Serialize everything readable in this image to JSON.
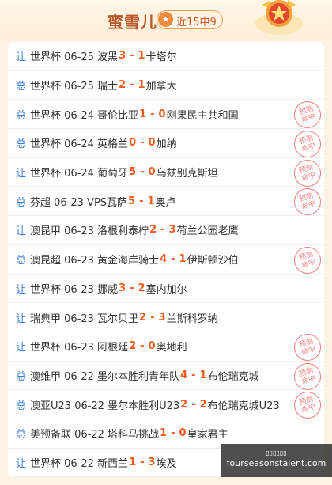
{
  "header": {
    "title": "蜜雪儿",
    "streak_label": "近15中9",
    "star_icon": "★"
  },
  "records": [
    {
      "tag": "让",
      "text": "世界杯 06-25 波黑",
      "s1": "3",
      "sep": "-",
      "s2": "1",
      "away": "卡塔尔",
      "stamp": false
    },
    {
      "tag": "总",
      "text": "世界杯 06-25 瑞士",
      "s1": "2",
      "sep": "-",
      "s2": "1",
      "away": "加拿大",
      "stamp": false
    },
    {
      "tag": "总",
      "text": "世界杯 06-24 哥伦比亚",
      "s1": "1",
      "sep": "-",
      "s2": "0",
      "away": "刚果民主共和国",
      "stamp": true
    },
    {
      "tag": "总",
      "text": "世界杯 06-24 英格兰",
      "s1": "0",
      "sep": "-",
      "s2": "0",
      "away": "加纳",
      "stamp": true
    },
    {
      "tag": "让",
      "text": "世界杯 06-24 葡萄牙",
      "s1": "5",
      "sep": "-",
      "s2": "0",
      "away": "乌兹别克斯坦",
      "stamp": true
    },
    {
      "tag": "总",
      "text": "芬超 06-23 VPS瓦萨",
      "s1": "5",
      "sep": "-",
      "s2": "1",
      "away": "奥卢",
      "stamp": true
    },
    {
      "tag": "让",
      "text": "澳昆甲 06-23 洛根利泰柠",
      "s1": "2",
      "sep": "-",
      "s2": "3",
      "away": "荷兰公园老鹰",
      "stamp": false
    },
    {
      "tag": "总",
      "text": "澳昆超 06-23 黄金海岸骑士",
      "s1": "4",
      "sep": "-",
      "s2": "1",
      "away": "伊斯顿沙伯",
      "stamp": true
    },
    {
      "tag": "让",
      "text": "世界杯 06-23 挪威",
      "s1": "3",
      "sep": "-",
      "s2": "2",
      "away": "塞内加尔",
      "stamp": false
    },
    {
      "tag": "让",
      "text": "瑞典甲 06-23 瓦尔贝里",
      "s1": "2",
      "sep": "-",
      "s2": "3",
      "away": "兰斯科罗纳",
      "stamp": false
    },
    {
      "tag": "让",
      "text": "世界杯 06-23 阿根廷",
      "s1": "2",
      "sep": "-",
      "s2": "0",
      "away": "奥地利",
      "stamp": true
    },
    {
      "tag": "总",
      "text": "澳维甲 06-22 墨尔本胜利青年队",
      "s1": "4",
      "sep": "-",
      "s2": "1",
      "away": "布伦瑞克城",
      "stamp": true
    },
    {
      "tag": "总",
      "text": "澳亚U23 06-22 墨尔本胜利U23",
      "s1": "2",
      "sep": "-",
      "s2": "2",
      "away": "布伦瑞克城U23",
      "stamp": true
    },
    {
      "tag": "总",
      "text": "美预备联 06-22 塔科马挑战",
      "s1": "1",
      "sep": "-",
      "s2": "0",
      "away": "皇家君主",
      "stamp": false
    },
    {
      "tag": "让",
      "text": "世界杯 06-22 新西兰",
      "s1": "1",
      "sep": "-",
      "s2": "3",
      "away": "埃及",
      "stamp": false
    }
  ],
  "stamp_text": "预测命中",
  "watermark": {
    "line1": "▯▯▯▯▯▯",
    "line2": "fourseasonstalent.com"
  },
  "colors": {
    "tag": "#3d7fd8",
    "score": "#f05a1a",
    "stamp": "#ef7d7d",
    "title": "#b8582a"
  }
}
